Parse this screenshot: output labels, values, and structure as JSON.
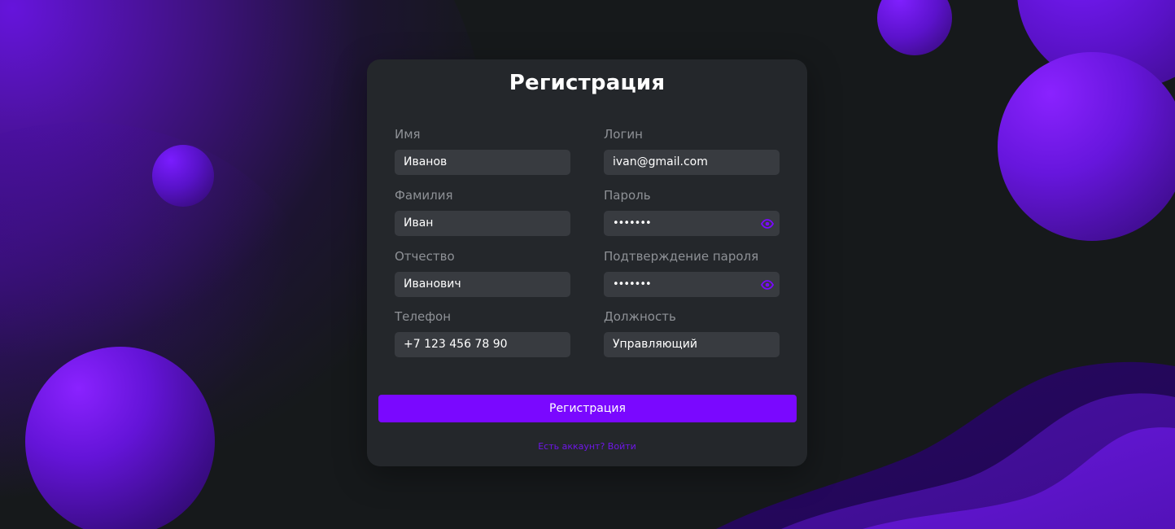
{
  "form": {
    "title": "Регистрация",
    "fields": {
      "first_name": {
        "label": "Имя",
        "value": "Иванов"
      },
      "login": {
        "label": "Логин",
        "value": "ivan@gmail.com"
      },
      "last_name": {
        "label": "Фамилия",
        "value": "Иван"
      },
      "password": {
        "label": "Пароль",
        "value": "•••••••"
      },
      "patronymic": {
        "label": "Отчество",
        "value": "Иванович"
      },
      "password_confirm": {
        "label": "Подтверждение пароля",
        "value": "•••••••"
      },
      "phone": {
        "label": "Телефон",
        "value": "+7 123 456 78 90"
      },
      "position": {
        "label": "Должность",
        "value": "Управляющий"
      }
    },
    "submit_label": "Регистрация",
    "login_link": "Есть аккаунт? Войти"
  },
  "icons": {
    "password_toggle": "eye-icon",
    "password_confirm_toggle": "eye-icon"
  },
  "colors": {
    "accent": "#7a08ff",
    "background": "#16191b",
    "card": "#24272b",
    "input": "#383b40",
    "label": "#8e9196"
  }
}
